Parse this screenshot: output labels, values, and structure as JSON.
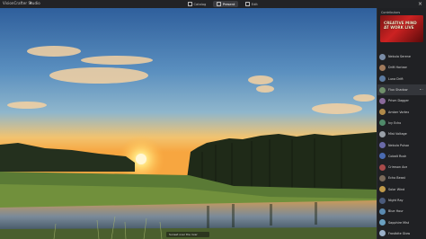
{
  "app": {
    "brand": "VisionCrafter Studio",
    "brand_icon": "sparkle-icon",
    "close_icon": "close-icon"
  },
  "tabs": [
    {
      "label": "Catalog",
      "icon": "grid-icon",
      "active": false
    },
    {
      "label": "Present",
      "icon": "play-icon",
      "active": true
    },
    {
      "label": "Edit",
      "icon": "sliders-icon",
      "active": false
    }
  ],
  "sidebar": {
    "title": "Contributors",
    "thumbnail_text": "CREATIVE MIND AT WORK LIVE",
    "items": [
      {
        "label": "Nebula Serene",
        "color": "#7a8ca6"
      },
      {
        "label": "Drift Horizon",
        "color": "#a07a5c"
      },
      {
        "label": "Luna Drift",
        "color": "#5c7aa0"
      },
      {
        "label": "Flux Shadow",
        "color": "#6f8f6a",
        "active": true,
        "extra": "• ·"
      },
      {
        "label": "Prism Dagger",
        "color": "#8a6a9a"
      },
      {
        "label": "Amber Vortex",
        "color": "#b08a4a"
      },
      {
        "label": "Ivy Echo",
        "color": "#4f8a6a"
      },
      {
        "label": "Mist Voltage",
        "color": "#9aa0a8"
      },
      {
        "label": "Nebula Pulsar",
        "color": "#6a6aa8"
      },
      {
        "label": "Cobalt Rush",
        "color": "#4a6ab0"
      },
      {
        "label": "Crimson Ace",
        "color": "#a84a4a"
      },
      {
        "label": "Echo Beast",
        "color": "#7a6a5a"
      },
      {
        "label": "Solar Wind",
        "color": "#c09a4a"
      },
      {
        "label": "Night Ray",
        "color": "#4a5a7a"
      },
      {
        "label": "Blue Hour",
        "color": "#5a8ab0"
      },
      {
        "label": "Sapphire Mist",
        "color": "#6aa0c0"
      },
      {
        "label": "Frostbite Glow",
        "color": "#9ab0c8"
      }
    ]
  },
  "caption": "Sunset over the river",
  "colors": {
    "topbar": "#222326",
    "panel": "#202124",
    "accent_tab": "#3a3b40"
  }
}
